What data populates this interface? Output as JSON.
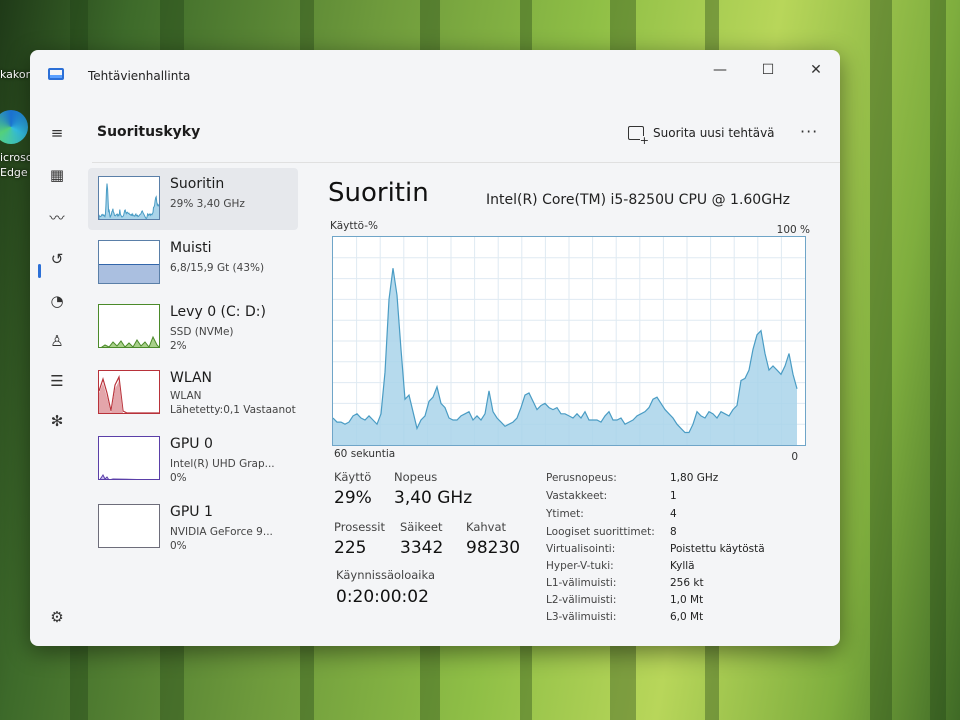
{
  "desktop": {
    "top_label": "kakor",
    "edge_label_1": "icrosof",
    "edge_label_2": "Edge"
  },
  "window": {
    "title": "Tehtävienhallinta",
    "minimize_glyph": "—",
    "maximize_glyph": "☐",
    "close_glyph": "✕"
  },
  "header": {
    "title": "Suorituskyky",
    "run_task_label": "Suorita uusi tehtävä",
    "more_glyph": "···"
  },
  "nav": {
    "icons": [
      "hamburger-icon",
      "processes-icon",
      "performance-icon",
      "app-history-icon",
      "startup-apps-icon",
      "users-icon",
      "details-icon",
      "services-icon",
      "settings-icon"
    ]
  },
  "sidebar": {
    "items": [
      {
        "name": "Suoritin",
        "sub1": "29% 3,40 GHz",
        "sub2": ""
      },
      {
        "name": "Muisti",
        "sub1": "6,8/15,9 Gt (43%)",
        "sub2": ""
      },
      {
        "name": "Levy 0 (C: D:)",
        "sub1": "SSD (NVMe)",
        "sub2": "2%"
      },
      {
        "name": "WLAN",
        "sub1": "WLAN",
        "sub2": "Lähetetty:0,1 Vastaanot"
      },
      {
        "name": "GPU 0",
        "sub1": "Intel(R) UHD Grap...",
        "sub2": "0%"
      },
      {
        "name": "GPU 1",
        "sub1": "NVIDIA GeForce 9...",
        "sub2": "0%"
      }
    ]
  },
  "main": {
    "title": "Suoritin",
    "cpu_model": "Intel(R) Core(TM) i5-8250U CPU @ 1.60GHz",
    "graph_top_left": "Käyttö-%",
    "graph_top_right": "100 %",
    "graph_bottom_left": "60 sekuntia",
    "graph_bottom_right": "0",
    "stats": {
      "usage_label": "Käyttö",
      "usage_value": "29%",
      "speed_label": "Nopeus",
      "speed_value": "3,40 GHz",
      "processes_label": "Prosessit",
      "processes_value": "225",
      "threads_label": "Säikeet",
      "threads_value": "3342",
      "handles_label": "Kahvat",
      "handles_value": "98230",
      "uptime_label": "Käynnissäoloaika",
      "uptime_value": "0:20:00:02"
    },
    "info": [
      {
        "key": "Perusnopeus:",
        "value": "1,80 GHz"
      },
      {
        "key": "Vastakkeet:",
        "value": "1"
      },
      {
        "key": "Ytimet:",
        "value": "4"
      },
      {
        "key": "Loogiset suorittimet:",
        "value": "8"
      },
      {
        "key": "Virtualisointi:",
        "value": "Poistettu käytöstä"
      },
      {
        "key": "Hyper-V-tuki:",
        "value": "Kyllä"
      },
      {
        "key": "L1-välimuisti:",
        "value": "256 kt"
      },
      {
        "key": "L2-välimuisti:",
        "value": "1,0 Mt"
      },
      {
        "key": "L3-välimuisti:",
        "value": "6,0 Mt"
      }
    ]
  },
  "colors": {
    "cpu_line": "#4a9cc4",
    "cpu_fill": "#a9d4ea",
    "memory_line": "#3366aa",
    "memory_fill": "#aabfe0",
    "disk_line": "#4b8a2a",
    "disk_fill": "#a8d08a",
    "wlan_line": "#b8323a",
    "gpu_line": "#5a3fa8"
  },
  "cpu_usage_history": [
    13,
    11,
    11,
    10,
    11,
    14,
    15,
    13,
    12,
    14,
    12,
    10,
    15,
    35,
    70,
    85,
    72,
    46,
    22,
    24,
    16,
    8,
    12,
    14,
    21,
    23,
    28,
    20,
    18,
    13,
    12,
    12,
    14,
    15,
    16,
    12,
    14,
    12,
    15,
    26,
    16,
    13,
    11,
    9,
    10,
    11,
    13,
    18,
    24,
    25,
    21,
    17,
    19,
    20,
    18,
    17,
    18,
    15,
    15,
    14,
    13,
    15,
    13,
    16,
    12,
    12,
    12,
    11,
    14,
    16,
    12,
    12,
    13,
    10,
    11,
    12,
    14,
    15,
    16,
    18,
    22,
    23,
    20,
    17,
    15,
    13,
    10,
    8,
    6,
    6,
    10,
    16,
    14,
    13,
    16,
    15,
    13,
    16,
    15,
    14,
    17,
    19,
    31,
    32,
    36,
    46,
    53,
    55,
    44,
    36,
    38,
    36,
    34,
    38,
    44,
    34,
    27
  ]
}
